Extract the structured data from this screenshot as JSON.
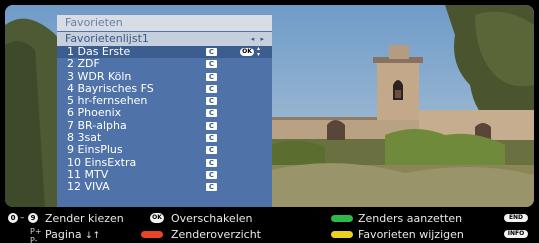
{
  "panel": {
    "title": "Favorieten",
    "list_name": "Favorietenlijst1",
    "list_arrows": "◂ ▸",
    "channel_badge": "C",
    "ok_badge": "OK",
    "updown": "▴▾",
    "channels": [
      {
        "label": "1 Das Erste",
        "selected": true
      },
      {
        "label": "2 ZDF",
        "selected": false
      },
      {
        "label": "3 WDR Köln",
        "selected": false
      },
      {
        "label": "4 Bayrisches FS",
        "selected": false
      },
      {
        "label": "5 hr-fernsehen",
        "selected": false
      },
      {
        "label": "6 Phoenix",
        "selected": false
      },
      {
        "label": "7 BR-alpha",
        "selected": false
      },
      {
        "label": "8 3sat",
        "selected": false
      },
      {
        "label": "9 EinsPlus",
        "selected": false
      },
      {
        "label": "10 EinsExtra",
        "selected": false
      },
      {
        "label": "11 MTV",
        "selected": false
      },
      {
        "label": "12 VIVA",
        "selected": false
      }
    ]
  },
  "help": {
    "num_start": "0",
    "num_end": "9",
    "zender_kiezen": "Zender kiezen",
    "pagina": "Pagina",
    "pagina_arrows": "↓↑",
    "ok_key": "OK",
    "overschakelen": "Overschakelen",
    "zenderoverzicht": "Zenderoverzicht",
    "zenders_aanzetten": "Zenders aanzetten",
    "favorieten_wijzigen": "Favorieten wijzigen",
    "end_key": "END",
    "info_key": "INFO"
  },
  "colors": {
    "red_key": "#e8442a",
    "green_key": "#2fb84a",
    "yellow_key": "#e8d21c",
    "panel_bg": "#4f73a8",
    "selected_row": "#3b5d90"
  }
}
